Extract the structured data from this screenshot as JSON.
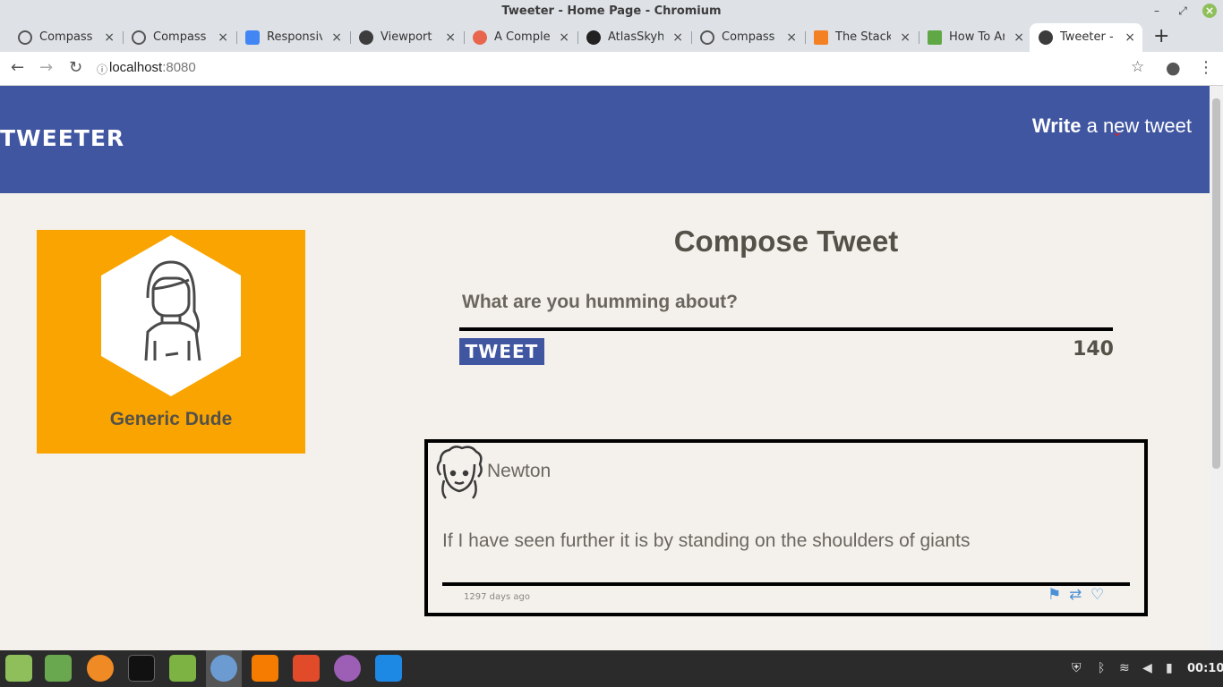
{
  "window": {
    "title": "Tweeter - Home Page - Chromium"
  },
  "tabs": [
    {
      "label": "Compass |",
      "favicon": "compass-icon"
    },
    {
      "label": "Compass |",
      "favicon": "compass-icon"
    },
    {
      "label": "Responsive",
      "favicon": "chrome-devtools-icon"
    },
    {
      "label": "Viewport",
      "favicon": "globe-icon"
    },
    {
      "label": "A Complete",
      "favicon": "css-tricks-icon"
    },
    {
      "label": "AtlasSkyhc",
      "favicon": "github-icon"
    },
    {
      "label": "Compass |",
      "favicon": "compass-icon"
    },
    {
      "label": "The Stack",
      "favicon": "stackoverflow-icon"
    },
    {
      "label": "How To Ar",
      "favicon": "digitalocean-icon"
    },
    {
      "label": "Tweeter -",
      "favicon": "globe-icon",
      "active": true
    }
  ],
  "address": {
    "host": "localhost",
    "port": ":8080"
  },
  "site": {
    "logo": "TWEETER",
    "nav_write_bold": "Write",
    "nav_write_rest": " a new tweet"
  },
  "profile": {
    "name": "Generic Dude",
    "color": "#f9a400"
  },
  "compose": {
    "title": "Compose Tweet",
    "placeholder": "What are you humming about?",
    "button": "TWEET",
    "counter": "140"
  },
  "tweets": [
    {
      "handle": "Newton",
      "content": "If I have seen further it is by standing on the shoulders of giants",
      "age": "1297 days ago"
    }
  ],
  "taskbar": {
    "clock": "00:10"
  },
  "colors": {
    "nav": "#4056a1",
    "page_bg": "#f4f1ec",
    "accent": "#f9a400"
  }
}
